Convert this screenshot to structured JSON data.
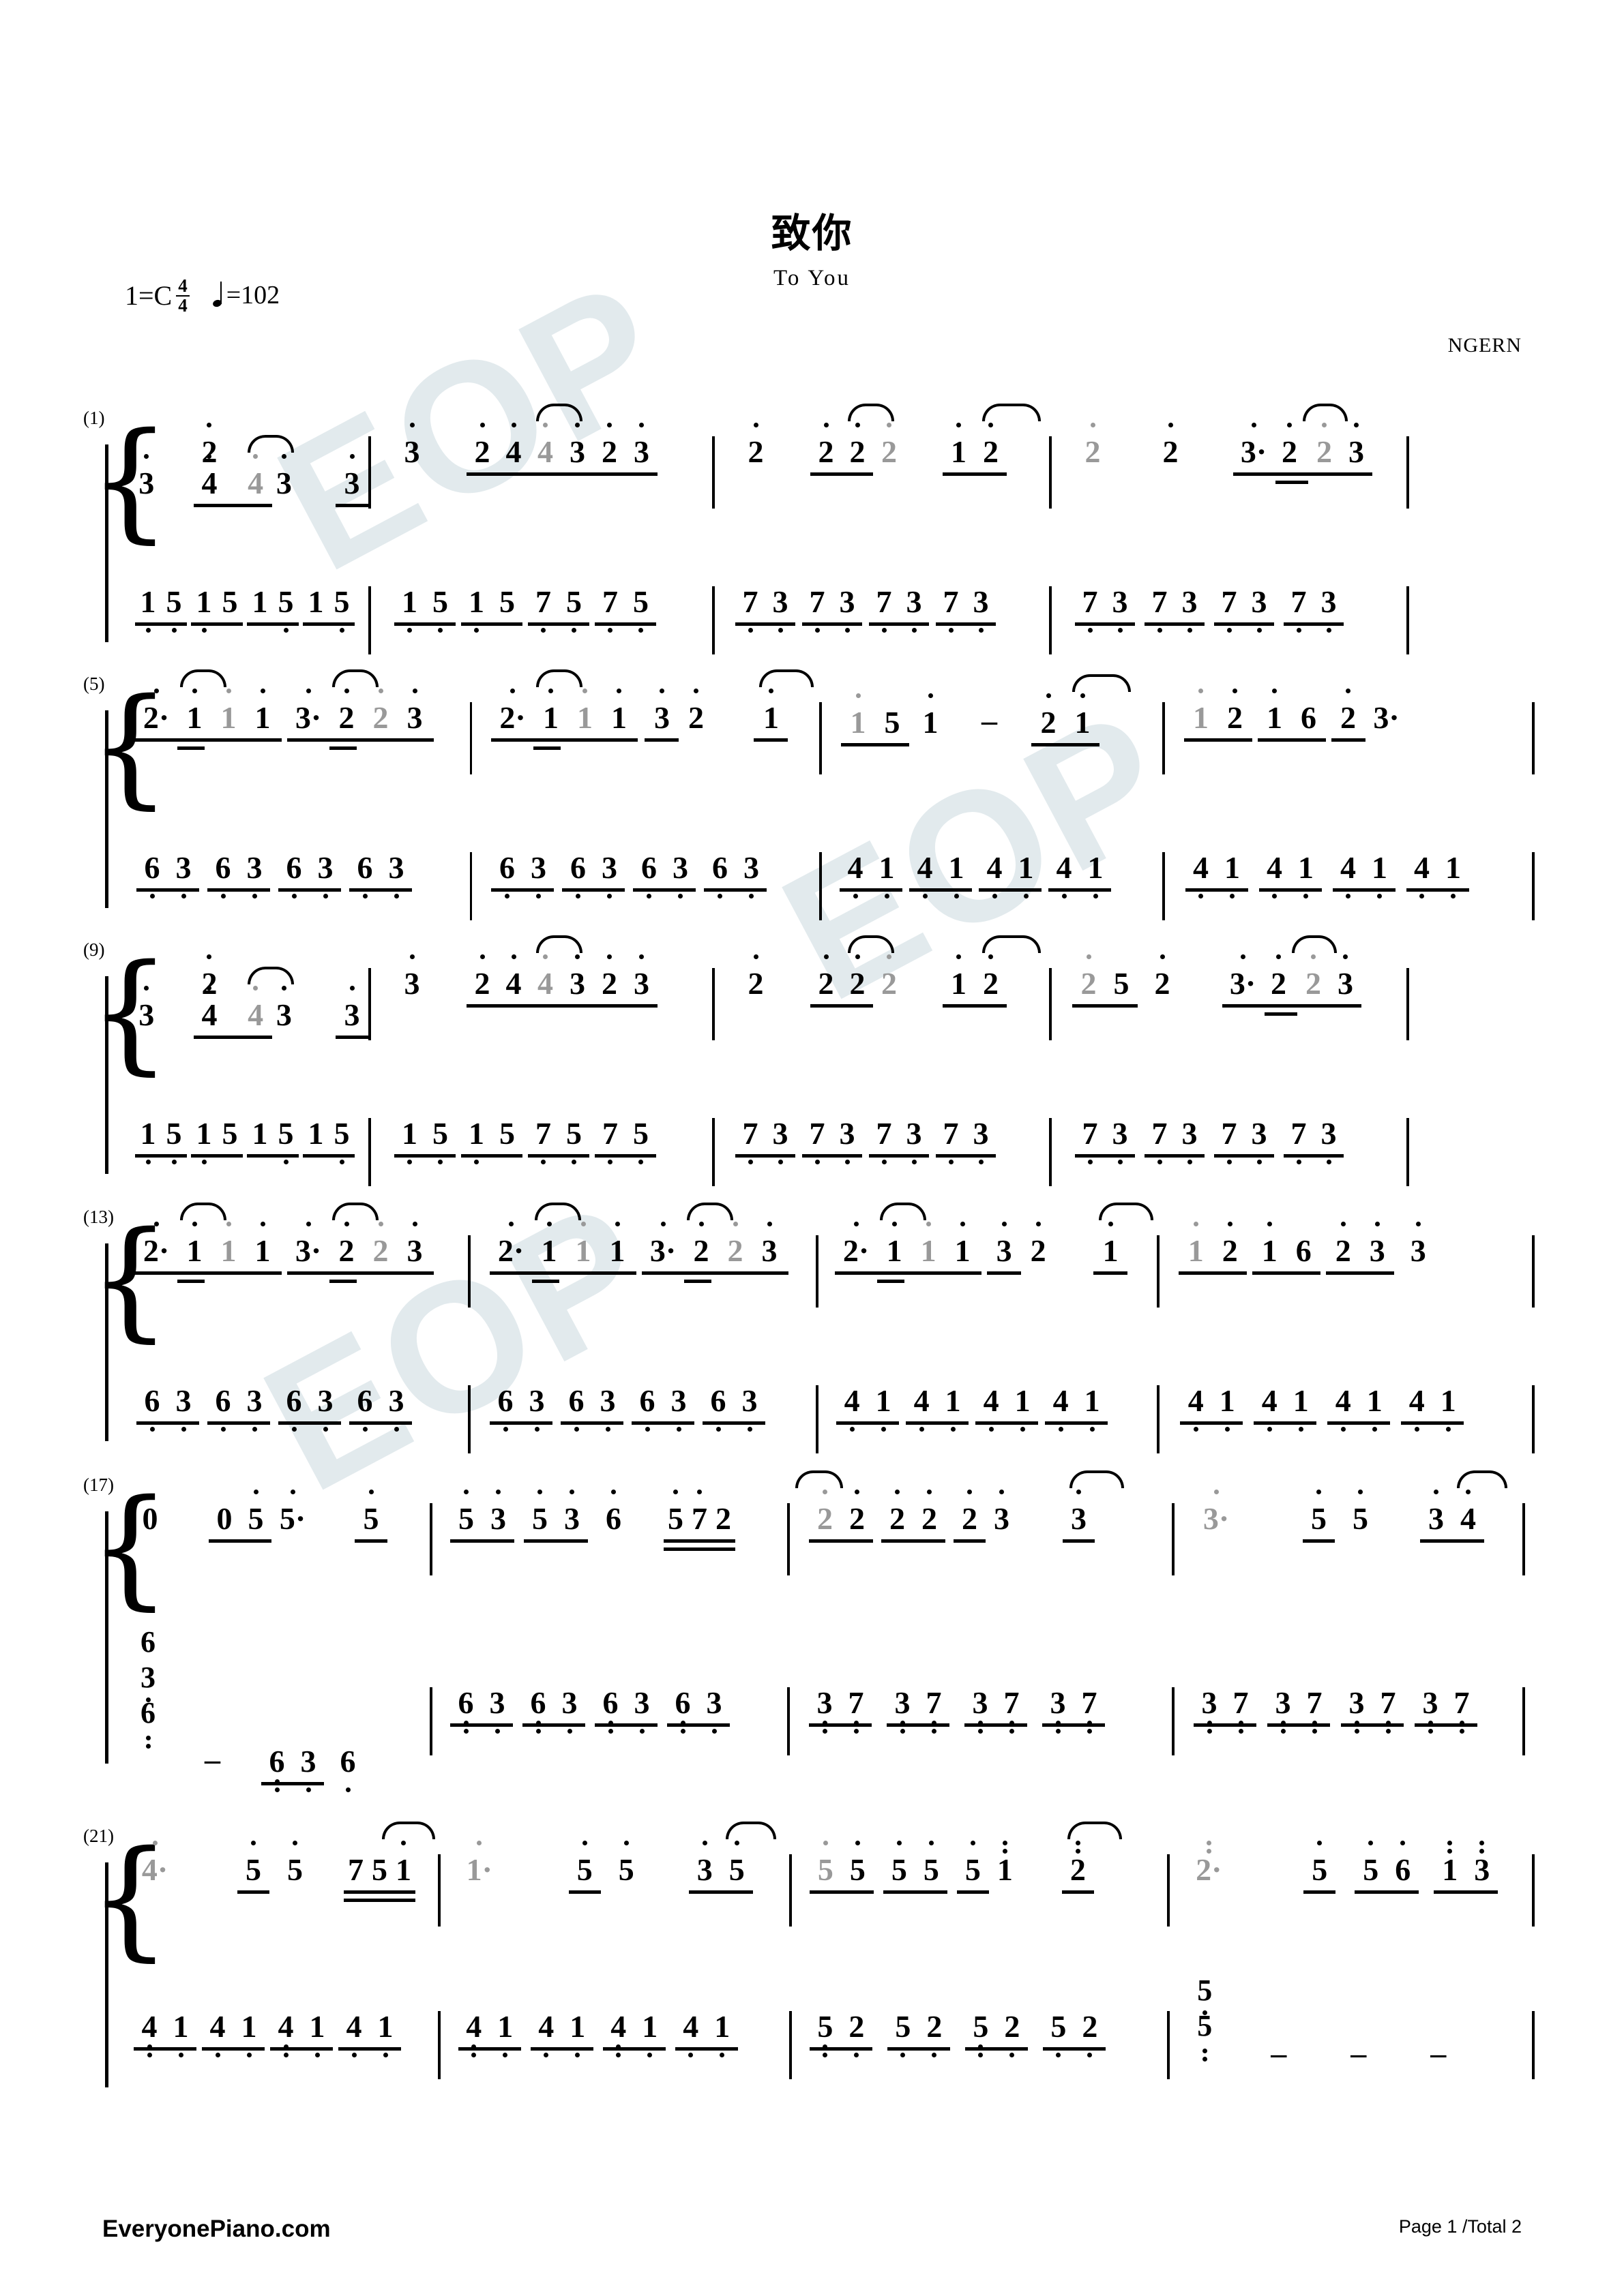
{
  "header": {
    "title": "致你",
    "subtitle": "To You",
    "composer": "NGERN",
    "key_label": "1=C",
    "time_numerator": "4",
    "time_denominator": "4",
    "tempo_equals": "=102"
  },
  "watermarks": [
    {
      "text": "EOP",
      "color": "#e2eaed"
    },
    {
      "text": "EOP",
      "color": "#e2eaed"
    },
    {
      "text": "EOP",
      "color": "#e2eaed"
    }
  ],
  "footer": {
    "site": "EveryonePiano.com",
    "page_info": "Page 1 /Total 2"
  },
  "notation": {
    "systems": [
      {
        "number": "(1)",
        "measures_treble": [
          "3  2 4 4 3  3",
          "3  2 4 4 3  2 3",
          "2  2 2 2  1 2",
          "2  2  3· 2 2 3"
        ],
        "measures_bass": [
          "1 5 1 5 1 5 1 5",
          "1 5 1 5 7 5 7 5",
          "7 3 7 3 7 3 7 3",
          "7 3 7 3 7 3 7 3"
        ]
      },
      {
        "number": "(5)",
        "measures_treble": [
          "2· 1 1 1  3· 2 2 3",
          "2· 1 1 1  3 2   1",
          "1 5 1  -  2 1",
          "1 2 1 6 2 3·"
        ],
        "measures_bass": [
          "6 3 6 3 6 3 6 3",
          "6 3 6 3 6 3 6 3",
          "4 1 4 1 4 1 4 1",
          "4 1 4 1 4 1 4 1"
        ]
      },
      {
        "number": "(9)",
        "measures_treble": [
          "3  2 4 4 3  3",
          "3  2 4 4 3  2 3",
          "2  2 2 2  1 2",
          "2 5 2  3· 2 2 3"
        ],
        "measures_bass": [
          "1 5 1 5 1 5 1 5",
          "1 5 1 5 7 5 7 5",
          "7 3 7 3 7 3 7 3",
          "7 3 7 3 7 3 7 3"
        ]
      },
      {
        "number": "(13)",
        "measures_treble": [
          "2· 1 1 1  3· 2 2 3",
          "2· 1 1 1  3· 2 2 3",
          "2· 1 1 1  3 2  1",
          "1 2 1 6 2 3 3"
        ],
        "measures_bass": [
          "6 3 6 3 6 3 6 3",
          "6 3 6 3 6 3 6 3",
          "4 1 4 1 4 1 4 1",
          "4 1 4 1 4 1 4 1"
        ]
      },
      {
        "number": "(17)",
        "measures_treble": [
          "0  0 5 5·  5",
          "5 3 5 3 6  5 7 2",
          "2 2 2 2 2 3  3",
          "3·  5 5  3 4"
        ],
        "measures_bass": [
          "6/3/6  -  6 3 6",
          "6 3 6 3 6 3 6 3",
          "3 7 3 7 3 7 3 7",
          "3 7 3 7 3 7 3 7"
        ]
      },
      {
        "number": "(21)",
        "measures_treble": [
          "4·  5 5  7 5 1",
          "1·  5 5  3 5",
          "5 5 5 5 5 1  2",
          "2·  5 5 6 1 3"
        ],
        "measures_bass": [
          "4 1 4 1 4 1 4 1",
          "4 1 4 1 4 1 4 1",
          "5 2 5 2 5 2 5 2",
          "5/5  -  -  -"
        ]
      }
    ]
  }
}
